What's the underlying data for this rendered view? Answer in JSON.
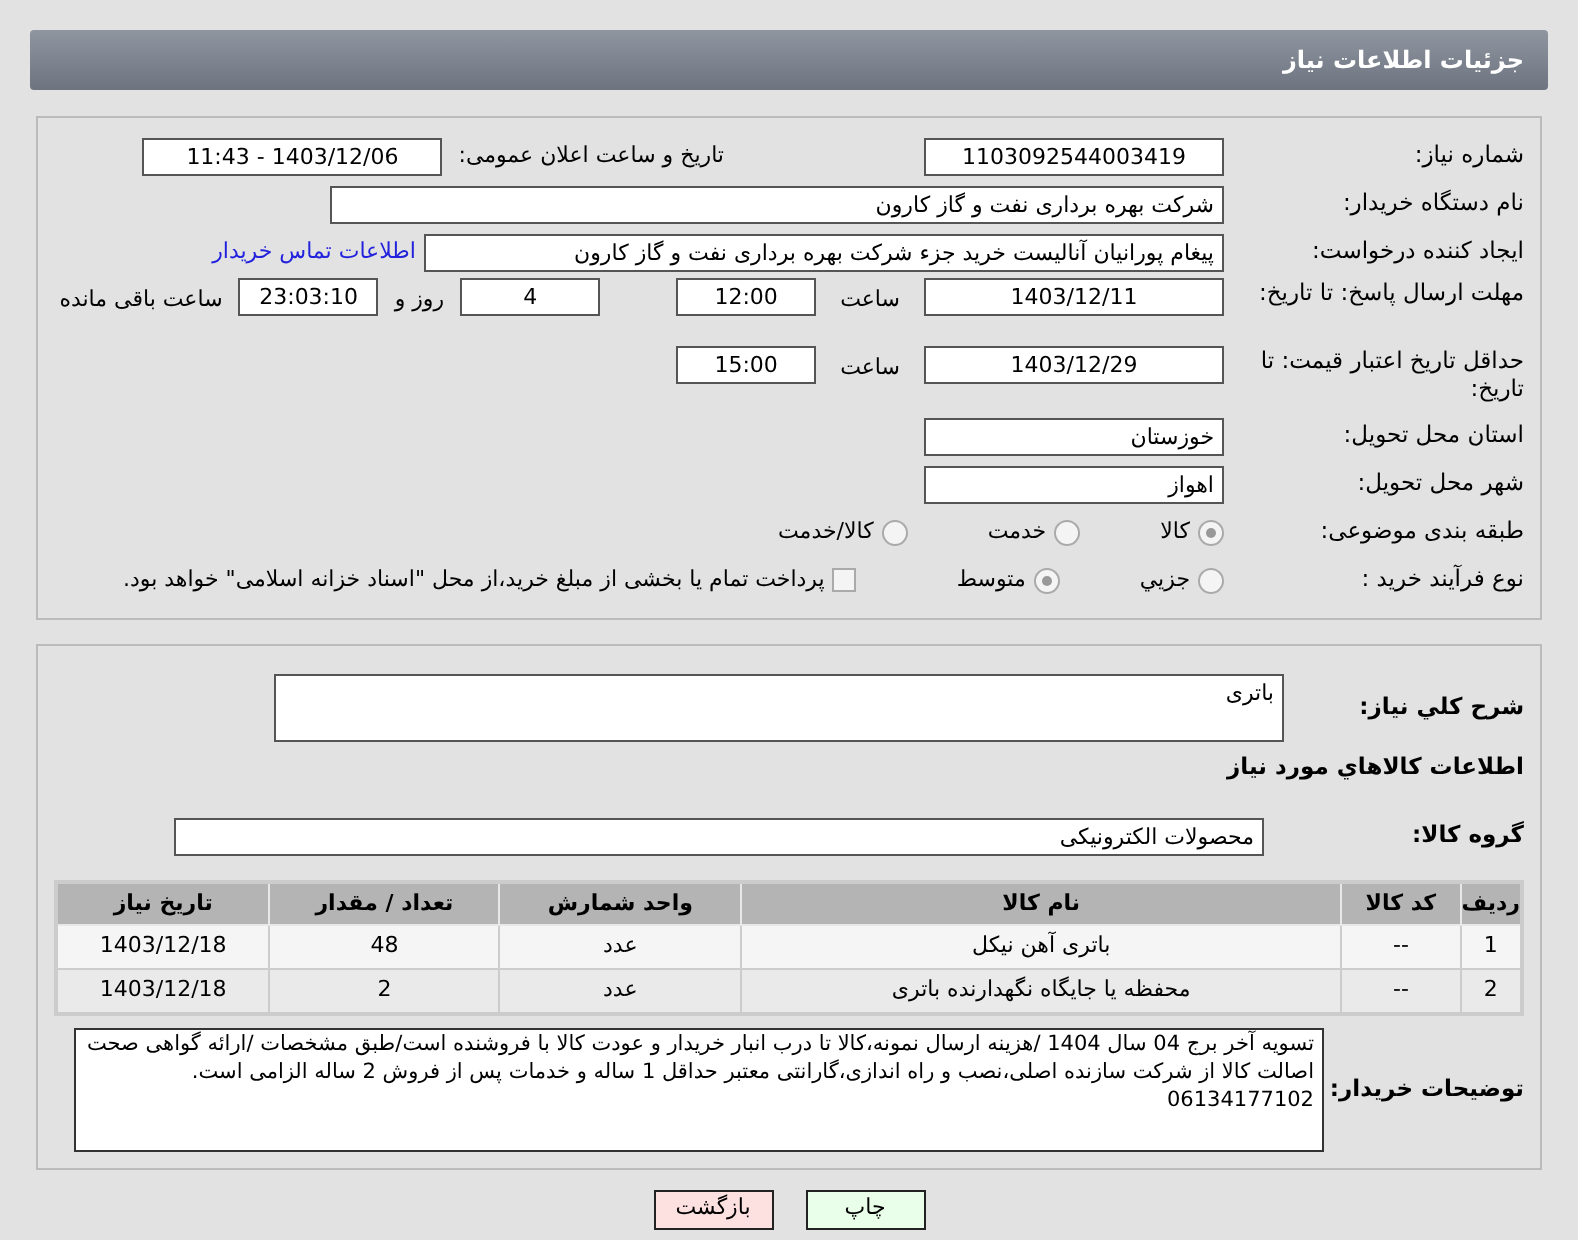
{
  "title": "جزئیات اطلاعات نیاز",
  "need_number": {
    "label": "شماره نیاز:",
    "value": "1103092544003419"
  },
  "announce": {
    "label": "تاریخ و ساعت اعلان عمومی:",
    "value": "1403/12/06 - 11:43"
  },
  "buyer": {
    "label": "نام دستگاه خریدار:",
    "value": "شرکت بهره برداری نفت و گاز کارون"
  },
  "requester": {
    "label": "ایجاد کننده درخواست:",
    "value": "پیغام پورانیان آنالیست خرید جزء شرکت بهره برداری نفت و گاز کارون",
    "link": "اطلاعات تماس خریدار"
  },
  "reply_deadline": {
    "label": "مهلت ارسال پاسخ: تا تاریخ:",
    "date": "1403/12/11",
    "time_label": "ساعت",
    "time": "12:00",
    "days": "4",
    "days_label": "روز و",
    "remaining": "23:03:10",
    "remaining_label": "ساعت باقی مانده"
  },
  "price_validity": {
    "label": "حداقل تاریخ اعتبار قیمت: تا تاریخ:",
    "date": "1403/12/29",
    "time_label": "ساعت",
    "time": "15:00"
  },
  "province": {
    "label": "استان محل تحویل:",
    "value": "خوزستان"
  },
  "city": {
    "label": "شهر محل تحویل:",
    "value": "اهواز"
  },
  "category": {
    "label": "طبقه بندی موضوعی:",
    "options": [
      {
        "label": "کالا",
        "selected": true
      },
      {
        "label": "خدمت",
        "selected": false
      },
      {
        "label": "کالا/خدمت",
        "selected": false
      }
    ]
  },
  "process": {
    "label": "نوع فرآیند خرید :",
    "options": [
      {
        "label": "جزیي",
        "selected": false
      },
      {
        "label": "متوسط",
        "selected": true
      }
    ],
    "payment": {
      "label": "پرداخت تمام یا بخشی از مبلغ خرید،از محل \"اسناد خزانه اسلامی\" خواهد بود.",
      "checked": false
    }
  },
  "description": {
    "label": "شرح کلي نیاز:",
    "value": "باتری"
  },
  "goods_title": "اطلاعات کالاهاي مورد نیاز",
  "goods_group": {
    "label": "گروه کالا:",
    "value": "محصولات الکترونیکی"
  },
  "table": {
    "columns": [
      "ردیف",
      "کد کالا",
      "نام کالا",
      "واحد شمارش",
      "تعداد / مقدار",
      "تاریخ نیاز"
    ],
    "rows": [
      [
        "1",
        "--",
        "باتری آهن نیکل",
        "عدد",
        "48",
        "1403/12/18"
      ],
      [
        "2",
        "--",
        "محفظه یا جایگاه نگهدارنده باتری",
        "عدد",
        "2",
        "1403/12/18"
      ]
    ]
  },
  "notes": {
    "label": "توضیحات خریدار:",
    "lines": [
      "تسویه آخر برج 04 سال 1404 /هزینه ارسال نمونه،کالا تا درب انبار خریدار و عودت کالا با فروشنده است/طبق مشخصات /ارائه گواهی صحت اصالت کالا از شرکت سازنده اصلی،نصب و راه اندازی،گارانتی معتبر حداقل 1 ساله و خدمات پس از فروش 2 ساله الزامی است.",
      "06134177102"
    ]
  },
  "buttons": [
    {
      "label": "چاپ",
      "kind": "print"
    },
    {
      "label": "بازگشت",
      "kind": "back"
    }
  ]
}
